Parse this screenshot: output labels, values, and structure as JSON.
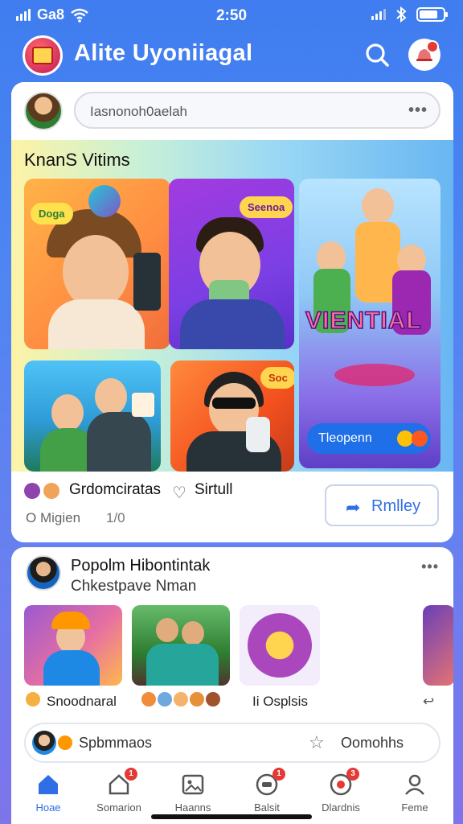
{
  "status_bar": {
    "carrier": "Ga8",
    "time": "2:50"
  },
  "header": {
    "title": "Alite Uyoniiagal",
    "search_icon": "search-icon",
    "notification_icon": "notification-icon"
  },
  "composer": {
    "placeholder": "Iasnonoh0aelah",
    "more": "•••"
  },
  "feature": {
    "title": "KnanS Vitims",
    "tiles": [
      {
        "badge": "Doga"
      },
      {
        "badge": "Seenoa"
      },
      {
        "badge": "VIENTIAL",
        "button": "Tleopenn"
      },
      {
        "badge": ""
      },
      {
        "badge": "Soc"
      }
    ],
    "reactions_label": "Grdomciratas",
    "secondary_label": "Sirtull",
    "meta_left": "O Migien",
    "meta_right": "1/0",
    "reply_button": "Rmlley"
  },
  "second_card": {
    "title": "Popolm Hibontintak",
    "subtitle": "Chkestpave Nman",
    "more": "•••",
    "captions": [
      "Snoodnaral",
      "",
      "Ii Osplsis"
    ],
    "comment_placeholder": "Spbmmaos",
    "comment_right": "Oomohhs"
  },
  "bottom_nav": [
    {
      "label": "Hoae",
      "icon": "home-icon",
      "badge": ""
    },
    {
      "label": "Somarion",
      "icon": "home-outline-icon",
      "badge": "1"
    },
    {
      "label": "Haanns",
      "icon": "gallery-icon",
      "badge": ""
    },
    {
      "label": "Balsit",
      "icon": "chat-icon",
      "badge": "1"
    },
    {
      "label": "Dlardnis",
      "icon": "notification-icon",
      "badge": "3"
    },
    {
      "label": "Feme",
      "icon": "profile-icon",
      "badge": ""
    }
  ],
  "colors": {
    "accent": "#2f6ee5",
    "badge": "#e53935",
    "background": "#4f86f2"
  }
}
